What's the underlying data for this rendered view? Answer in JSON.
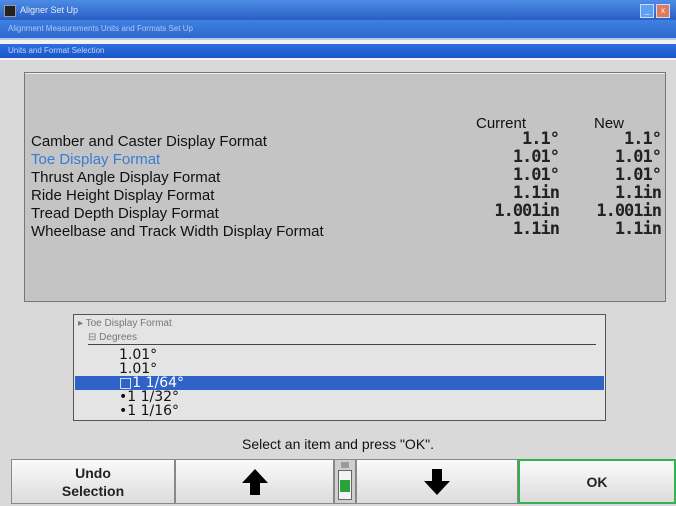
{
  "window": {
    "title": "Aligner Set Up",
    "subtitle": "Alignment Measurements Units and Formats Set Up",
    "section": "Units and Format Selection"
  },
  "table": {
    "col_current": "Current",
    "col_new": "New",
    "rows": [
      {
        "label": "Camber and Caster Display Format",
        "current": "1.1°",
        "new": "1.1°",
        "highlighted": false
      },
      {
        "label": "Toe Display Format",
        "current": "1.01°",
        "new": "1.01°",
        "highlighted": true
      },
      {
        "label": "Thrust Angle Display Format",
        "current": "1.01°",
        "new": "1.01°",
        "highlighted": false
      },
      {
        "label": "Ride Height Display Format",
        "current": "1.1in",
        "new": "1.1in",
        "highlighted": false
      },
      {
        "label": "Tread Depth Display Format",
        "current": "1.001in",
        "new": "1.001in",
        "highlighted": false
      },
      {
        "label": "Wheelbase and Track Width Display Format",
        "current": "1.1in",
        "new": "1.1in",
        "highlighted": false
      }
    ]
  },
  "listbox": {
    "header": "Toe Display Format",
    "group": "Degrees",
    "items": [
      {
        "label": "1.01°",
        "marker": "",
        "selected": false
      },
      {
        "label": "1.01°",
        "marker": "",
        "selected": false
      },
      {
        "label": "1 1/64°",
        "marker": "□",
        "selected": true
      },
      {
        "label": "1 1/32°",
        "marker": "•",
        "selected": false
      },
      {
        "label": "1 1/16°",
        "marker": "•",
        "selected": false
      }
    ]
  },
  "prompt": "Select an item and press \"OK\".",
  "buttons": {
    "undo_line1": "Undo",
    "undo_line2": "Selection",
    "up_icon": "arrow-up-icon",
    "down_icon": "arrow-down-icon",
    "ok": "OK"
  },
  "colors": {
    "highlight_text": "#3a7bd5",
    "selection_bg": "#2f63c8",
    "ok_border": "#2fb34a"
  }
}
